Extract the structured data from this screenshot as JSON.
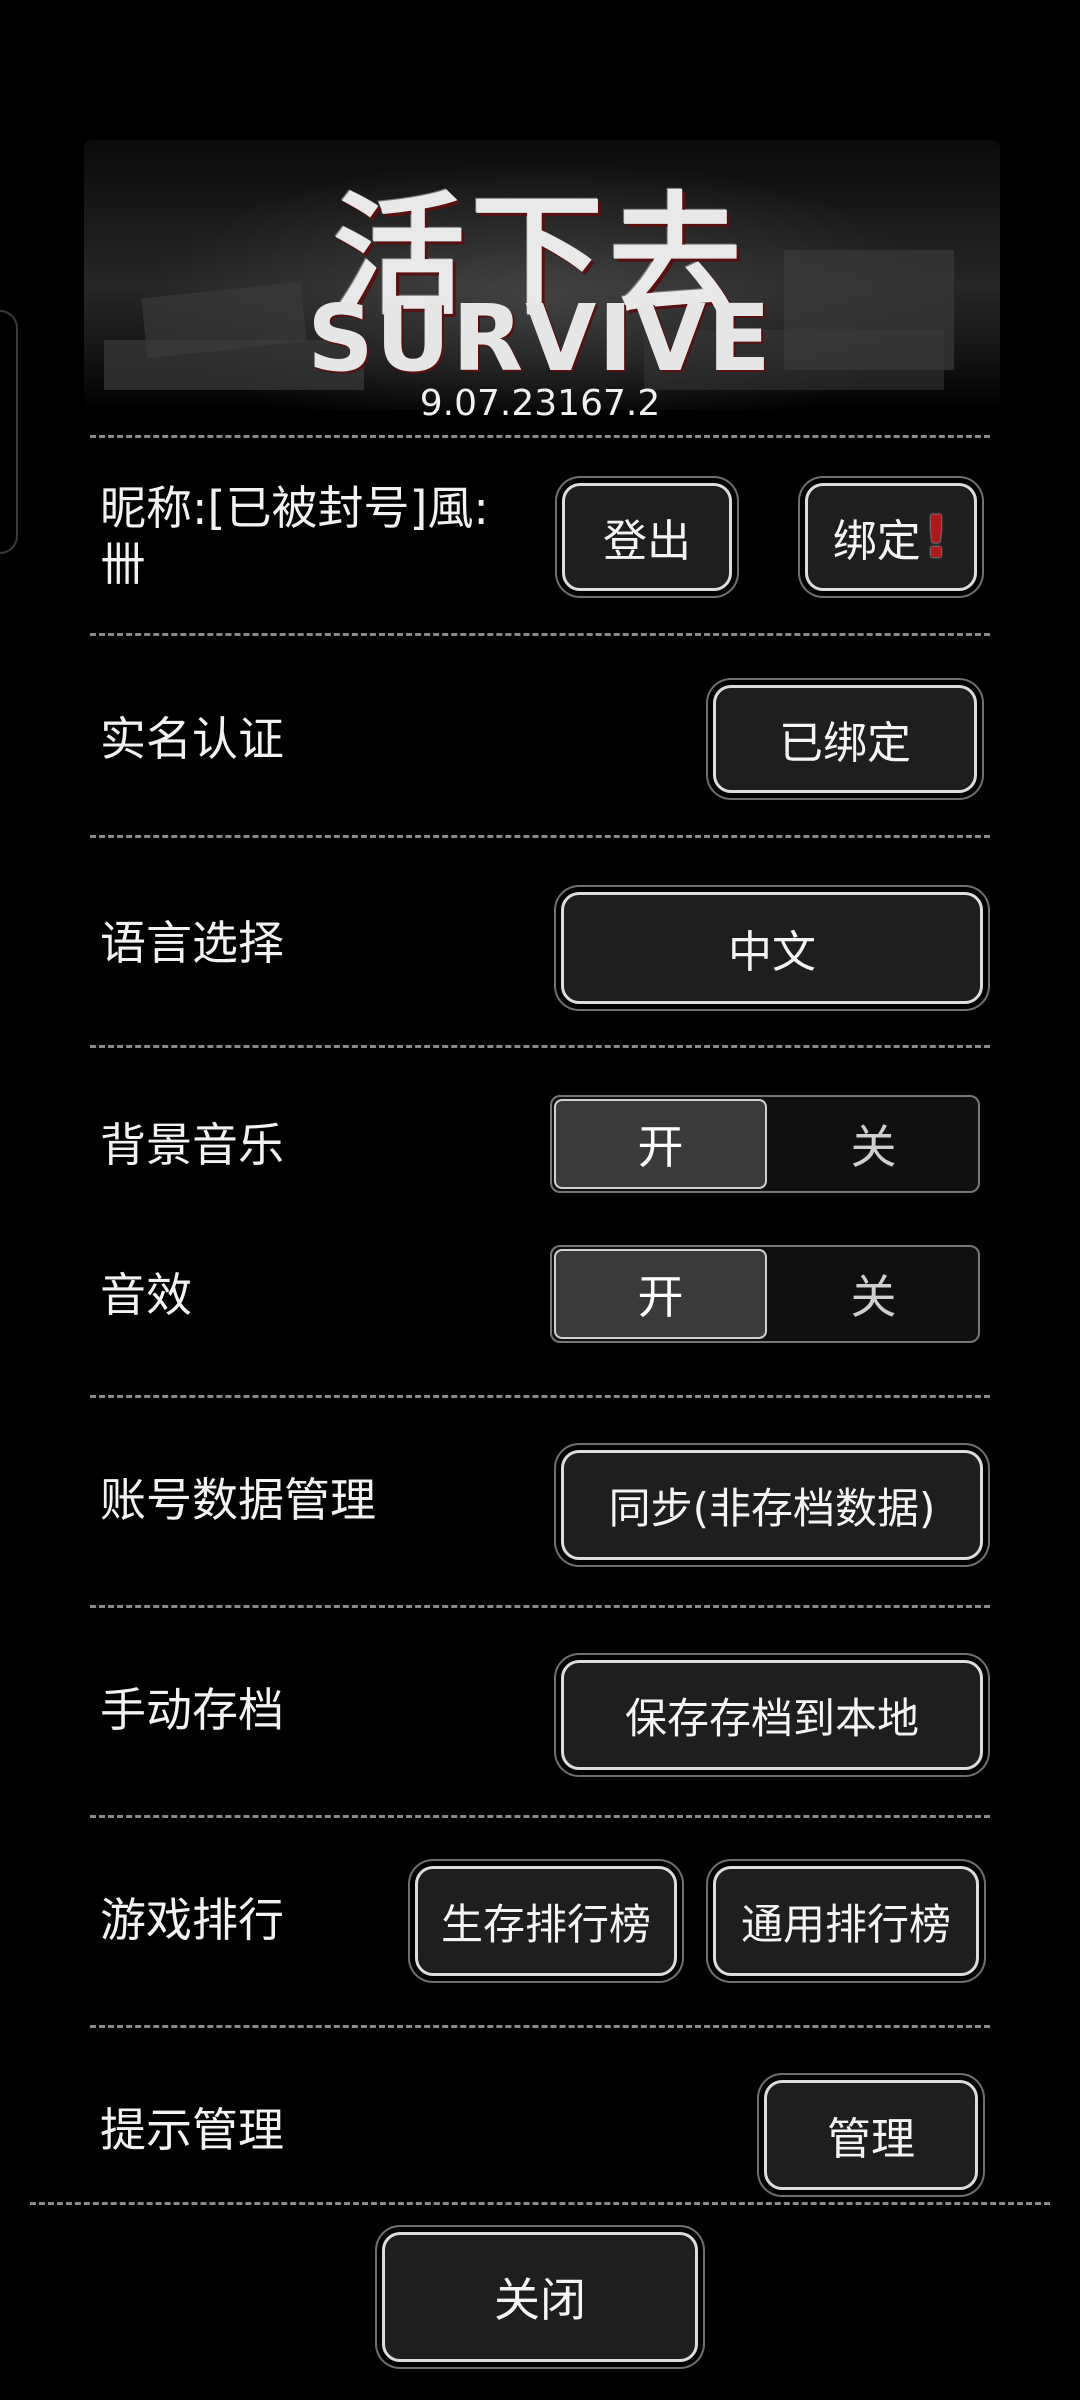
{
  "header": {
    "logo_cn": "活下去",
    "logo_en": "SURVIVE",
    "version": "9.07.23167.2"
  },
  "account": {
    "nickname_label": "昵称:[已被封号]風:\n卌",
    "logout_label": "登出",
    "bind_label": "绑定",
    "bind_alert": "!"
  },
  "real_name": {
    "label": "实名认证",
    "button": "已绑定"
  },
  "language": {
    "label": "语言选择",
    "button": "中文"
  },
  "bgm": {
    "label": "背景音乐",
    "on": "开",
    "off": "关",
    "selected": "on"
  },
  "sfx": {
    "label": "音效",
    "on": "开",
    "off": "关",
    "selected": "on"
  },
  "account_data": {
    "label": "账号数据管理",
    "button": "同步(非存档数据)"
  },
  "manual_save": {
    "label": "手动存档",
    "button": "保存存档到本地"
  },
  "ranking": {
    "label": "游戏排行",
    "survival_button": "生存排行榜",
    "general_button": "通用排行榜"
  },
  "tips": {
    "label": "提示管理",
    "button": "管理"
  },
  "footer": {
    "close_button": "关闭"
  },
  "colors": {
    "background": "#000000",
    "button_fill": "#1e1e1e",
    "button_border": "#dcdcdc",
    "alert": "#b01818",
    "toggle_on": "#3a3a3a"
  }
}
